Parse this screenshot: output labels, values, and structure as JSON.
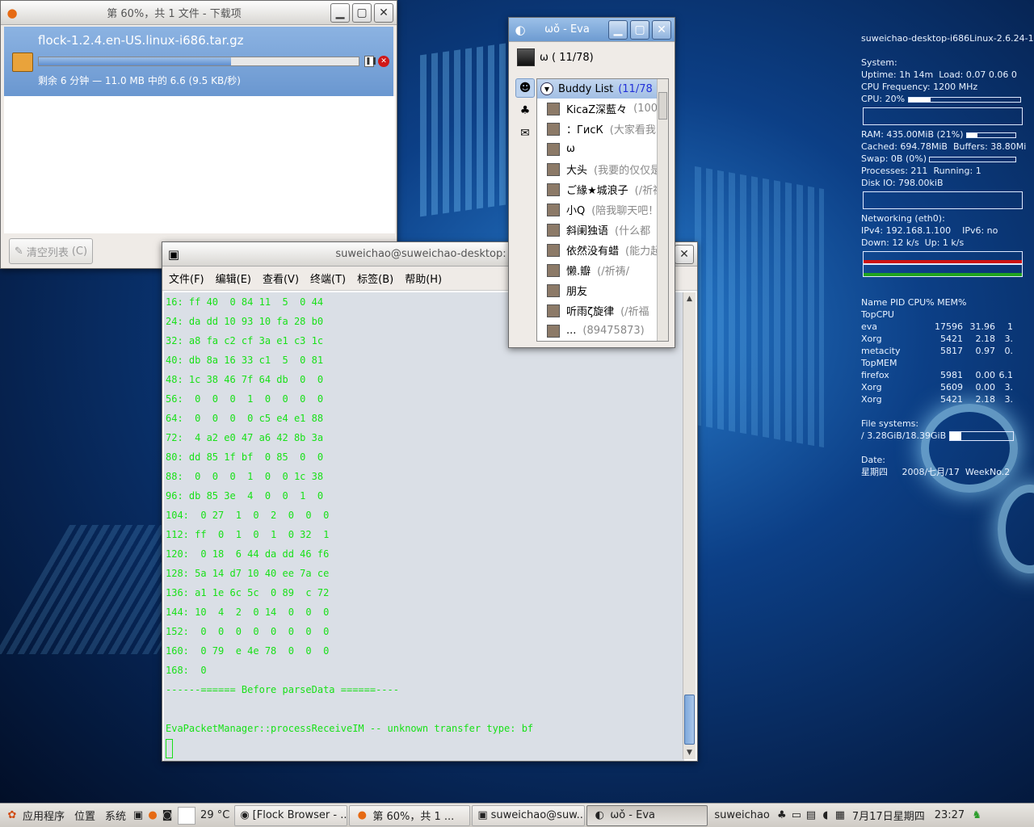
{
  "download": {
    "title": "第 60%，共 1 文件 - 下载项",
    "filename": "flock-1.2.4.en-US.linux-i686.tar.gz",
    "progress": 0.6,
    "status": "剩余 6 分钟 — 11.0 MB 中的 6.6 (9.5 KB/秒)",
    "clear_label": "清空列表",
    "clear_key": "(C)"
  },
  "terminal": {
    "title": "suweichao@suweichao-desktop: ~",
    "menu": [
      "文件(F)",
      "编辑(E)",
      "查看(V)",
      "终端(T)",
      "标签(B)",
      "帮助(H)"
    ],
    "lines": [
      "16: ff 40  0 84 11  5  0 44",
      "24: da dd 10 93 10 fa 28 b0",
      "32: a8 fa c2 cf 3a e1 c3 1c",
      "40: db 8a 16 33 c1  5  0 81",
      "48: 1c 38 46 7f 64 db  0  0",
      "56:  0  0  0  1  0  0  0  0",
      "64:  0  0  0  0 c5 e4 e1 88",
      "72:  4 a2 e0 47 a6 42 8b 3a",
      "80: dd 85 1f bf  0 85  0  0",
      "88:  0  0  0  1  0  0 1c 38",
      "96: db 85 3e  4  0  0  1  0",
      "104:  0 27  1  0  2  0  0  0",
      "112: ff  0  1  0  1  0 32  1",
      "120:  0 18  6 44 da dd 46 f6",
      "128: 5a 14 d7 10 40 ee 7a ce",
      "136: a1 1e 6c 5c  0 89  c 72",
      "144: 10  4  2  0 14  0  0  0",
      "152:  0  0  0  0  0  0  0  0",
      "160:  0 79  e 4e 78  0  0  0",
      "168:  0",
      "------====== Before parseData ======----",
      "",
      "EvaPacketManager::processReceiveIM -- unknown transfer type: bf"
    ]
  },
  "eva": {
    "title": "ωǒ - Eva",
    "user": "ω ( 11/78)",
    "list_label": "Buddy List",
    "list_count": "(11/78",
    "buddies": [
      {
        "name": "KicaZ深藍々",
        "note": "(100"
      },
      {
        "name": "：ГисК",
        "note": "(大家看我"
      },
      {
        "name": "ω",
        "note": ""
      },
      {
        "name": "大头",
        "note": "(我要的仅仅是"
      },
      {
        "name": "ご緣★城浪子",
        "note": "(/祈祷"
      },
      {
        "name": "小Q",
        "note": "(陪我聊天吧！"
      },
      {
        "name": "斜阑独语",
        "note": "(什么都"
      },
      {
        "name": "依然没有蜡",
        "note": "(能力起"
      },
      {
        "name": "懒.瓣",
        "note": "(/祈祷/"
      },
      {
        "name": "朋友",
        "note": ""
      },
      {
        "name": "听雨ζ旋律",
        "note": "(/祈福"
      },
      {
        "name": "...",
        "note": "(89475873)"
      }
    ]
  },
  "conky": {
    "host": "suweichao-desktop-i686Linux-2.6.24-1",
    "system_label": "System:",
    "uptime": "Uptime: 1h 14m",
    "load": "Load: 0.07 0.06 0",
    "cpu_freq": "CPU Frequency: 1200 MHz",
    "cpu": "CPU: 20%",
    "cpu_pct": 0.2,
    "ram": "RAM: 435.00MiB (21%)",
    "ram_pct": 0.21,
    "cached": "Cached: 694.78MiB",
    "buffers": "Buffers: 38.80Mi",
    "swap": "Swap: 0B (0%)",
    "processes": "Processes: 211",
    "running": "Running: 1",
    "disk_io": "Disk IO: 798.00kiB",
    "net_label": "Networking (eth0):",
    "ipv4": "IPv4: 192.168.1.100",
    "ipv6": "IPv6: no",
    "down": "Down: 12 k/s",
    "up": "Up: 1 k/s",
    "proc_header": "Name PID CPU% MEM%",
    "topcpu_label": "TopCPU",
    "topcpu": [
      [
        "eva",
        "17596",
        "31.96",
        "1"
      ],
      [
        "Xorg",
        "5421",
        "2.18",
        "3."
      ],
      [
        "metacity",
        "5817",
        "0.97",
        "0."
      ]
    ],
    "topmem_label": "TopMEM",
    "topmem": [
      [
        "firefox",
        "5981",
        "0.00",
        "6.1"
      ],
      [
        "Xorg",
        "5609",
        "0.00",
        "3."
      ],
      [
        "Xorg",
        "5421",
        "2.18",
        "3."
      ]
    ],
    "fs_label": "File systems:",
    "fs": "/  3.28GiB/18.39GiB",
    "fs_pct": 0.18,
    "date_label": "Date:",
    "weekday": "星期四",
    "date": "2008/七月/17",
    "weekno": "WeekNo.2"
  },
  "taskbar": {
    "apps": "应用程序",
    "places": "位置",
    "system": "系统",
    "temp": "29 °C",
    "tasks": [
      "[Flock Browser - ...",
      "第 60%，共 1 ...",
      "suweichao@suw...",
      "ωǒ - Eva"
    ],
    "user": "suweichao",
    "datetime": "7月17日星期四",
    "clock": "23:27"
  },
  "colors": {
    "accent": "#6d9bd1",
    "terminal_text": "#18e018"
  }
}
